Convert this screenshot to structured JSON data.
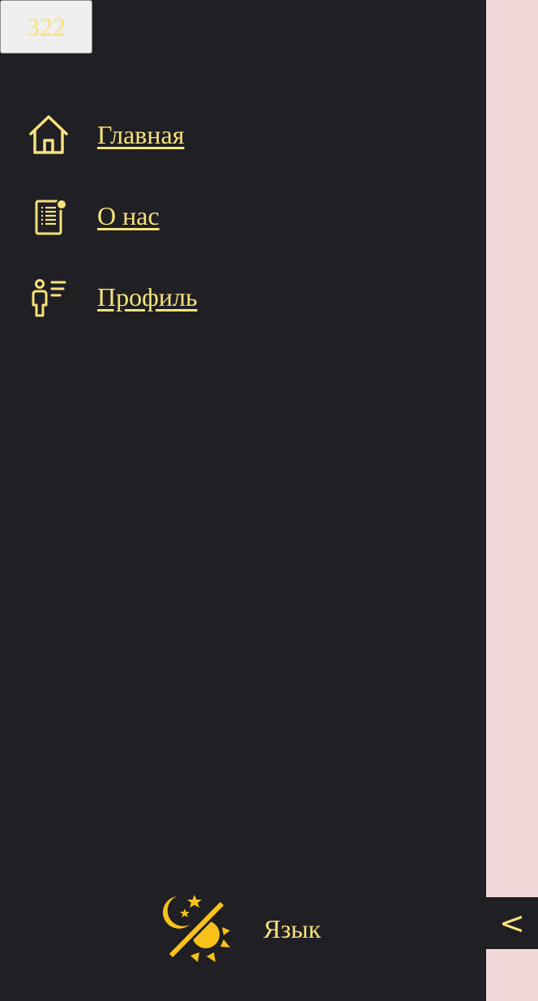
{
  "counter": {
    "value": "322"
  },
  "nav": {
    "items": [
      {
        "label": "Главная",
        "icon": "home-icon"
      },
      {
        "label": "О нас",
        "icon": "document-notification-icon"
      },
      {
        "label": "Профиль",
        "icon": "user-list-icon"
      }
    ]
  },
  "footer": {
    "language_label": "Язык",
    "theme_icon": "day-night-theme-icon"
  },
  "collapse": {
    "label": "<"
  },
  "colors": {
    "sidebar_bg": "#201f24",
    "page_bg": "#f2d8d9",
    "accent_text": "#f6e27a",
    "theme_icon": "#f8c21a"
  }
}
